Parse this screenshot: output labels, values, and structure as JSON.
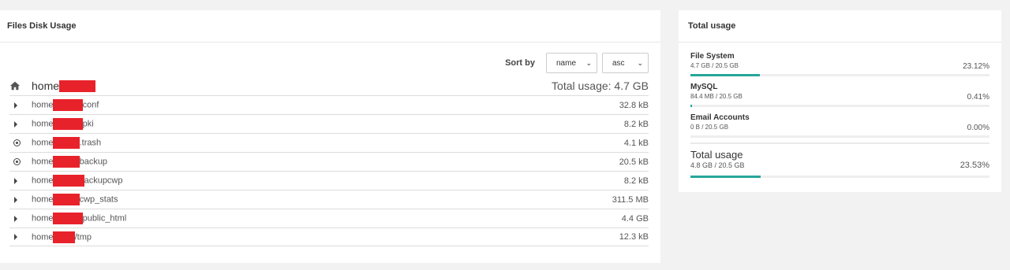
{
  "files_panel": {
    "title": "Files Disk Usage",
    "sort_label": "Sort by",
    "sort_field": "name",
    "sort_order": "asc",
    "home": {
      "label": "home",
      "total": "Total usage: 4.7 GB"
    },
    "rows": [
      {
        "icon": "caret-right-icon",
        "prefix": "home/",
        "suffix": "conf",
        "size": "32.8 kB"
      },
      {
        "icon": "caret-right-icon",
        "prefix": "home/",
        "suffix": "pki",
        "size": "8.2 kB"
      },
      {
        "icon": "radio-dot-icon",
        "prefix": "home/",
        "suffix": ".trash",
        "size": "4.1 kB"
      },
      {
        "icon": "radio-dot-icon",
        "prefix": "home/",
        "suffix": "backup",
        "size": "20.5 kB"
      },
      {
        "icon": "caret-right-icon",
        "prefix": "home/",
        "suffix": "ackupcwp",
        "size": "8.2 kB"
      },
      {
        "icon": "caret-right-icon",
        "prefix": "home/",
        "suffix": "cwp_stats",
        "size": "311.5 MB"
      },
      {
        "icon": "caret-right-icon",
        "prefix": "home/",
        "suffix": "public_html",
        "size": "4.4 GB"
      },
      {
        "icon": "caret-right-icon",
        "prefix": "home/",
        "suffix": "/tmp",
        "size": "12.3 kB"
      }
    ]
  },
  "usage_panel": {
    "title": "Total usage",
    "items": [
      {
        "name": "File System",
        "detail": "4.7 GB / 20.5 GB",
        "percent": "23.12%",
        "fraction": 0.2312
      },
      {
        "name": "MySQL",
        "detail": "84.4 MB / 20.5 GB",
        "percent": "0.41%",
        "fraction": 0.0041
      },
      {
        "name": "Email Accounts",
        "detail": "0 B / 20.5 GB",
        "percent": "0.00%",
        "fraction": 0.0
      }
    ],
    "total": {
      "name": "Total usage",
      "detail": "4.8 GB / 20.5 GB",
      "percent": "23.53%",
      "fraction": 0.2353
    }
  },
  "colors": {
    "bar_fill": "#26a69a",
    "redaction": "#e8222b"
  }
}
